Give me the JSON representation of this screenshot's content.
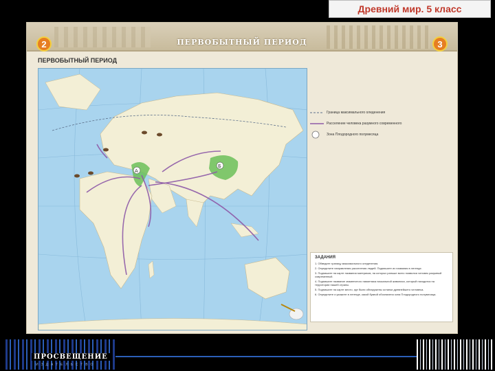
{
  "header": {
    "title": "Древний мир. 5 класс"
  },
  "sheet": {
    "page_left": "2",
    "page_right": "3",
    "banner_title": "ПЕРВОБЫТНЫЙ     ПЕРИОД",
    "section_title": "ПЕРВОБЫТНЫЙ ПЕРИОД",
    "map": {
      "label_a": "А",
      "label_b": "Б"
    },
    "legend": [
      "Граница максимального оледенения",
      "Расселение человека разумного современного",
      "Зона Плодородного полумесяца"
    ],
    "tasks": {
      "title": "ЗАДАНИЯ",
      "items": [
        "1. Обведите границу максимального оледенения.",
        "2. Определите направления расселения людей. Подпишите их названия в легенде.",
        "3. Подпишите на карте названия материков, на которых раньше всего появился человек разумный современный.",
        "4. Подпишите название знаменитого памятника наскальной живописи, который находится на территории нашей страны.",
        "5. Подпишите на карте место, где были обнаружены останки древнейшего человека.",
        "6. Определите и укажите в легенде, какой буквой обозначена зона Плодородного полумесяца."
      ]
    }
  },
  "footer": {
    "publisher": "ПРОСВЕЩЕНИЕ",
    "publisher_sub": "ИЗДАТЕЛЬСТВО"
  },
  "colors": {
    "accent": "#c0392b",
    "badge": "#e67e22",
    "sea": "#a9d4ee",
    "land": "#f3efd6",
    "zone": "#6bbf59",
    "route": "#8e5aa8"
  }
}
